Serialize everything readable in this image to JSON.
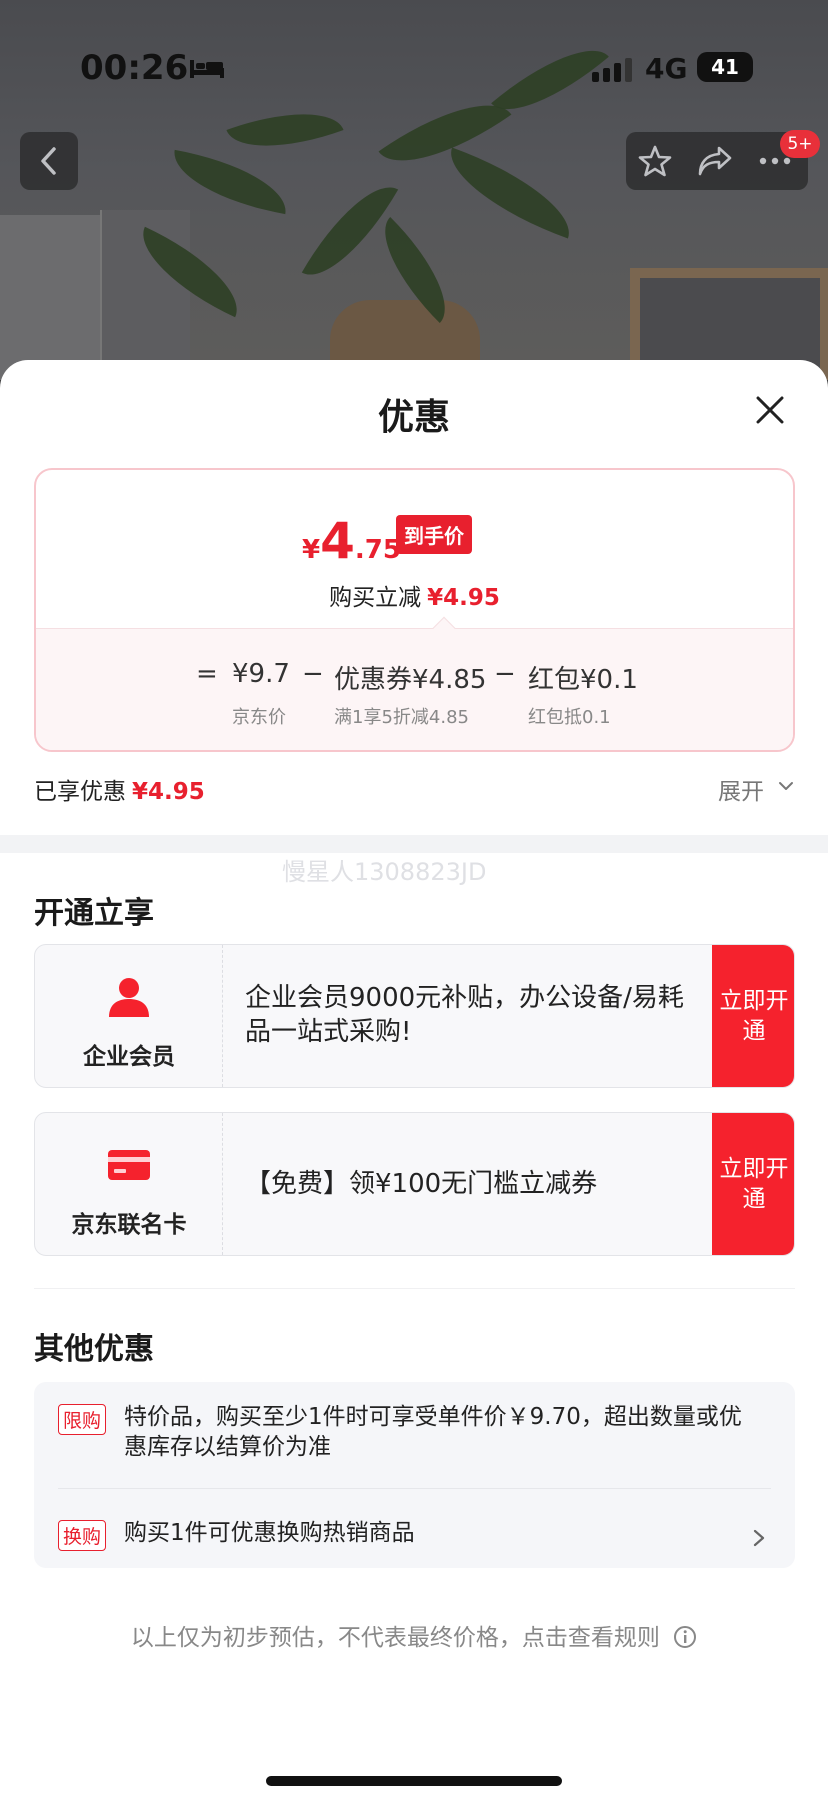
{
  "status_bar": {
    "time": "00:26",
    "network": "4G",
    "battery": "41"
  },
  "top_nav": {
    "badge": "5+"
  },
  "sheet": {
    "title": "优惠",
    "price_card": {
      "currency": "¥",
      "final_int": "4",
      "final_dec": ".75",
      "final_tag": "到手价",
      "reduce_label": "购买立减",
      "reduce_value": "¥4.95",
      "formula": {
        "equals": "=",
        "base_price": "¥9.7",
        "base_label": "京东价",
        "minus1": "−",
        "coupon": "优惠券¥4.85",
        "coupon_label": "满1享5折减4.85",
        "minus2": "−",
        "redpacket": "红包¥0.1",
        "redpacket_label": "红包抵0.1"
      }
    },
    "enjoyed_label": "已享优惠",
    "enjoyed_value": "¥4.95",
    "expand_label": "展开",
    "watermark": "慢星人1308823JD",
    "open_section": {
      "title": "开通立享",
      "cards": [
        {
          "name": "企业会员",
          "description": "企业会员9000元补贴，办公设备/易耗品一站式采购!",
          "button": "立即开通"
        },
        {
          "name": "京东联名卡",
          "description": "【免费】领¥100无门槛立减券",
          "button": "立即开通"
        }
      ]
    },
    "other_section": {
      "title": "其他优惠",
      "items": [
        {
          "tag": "限购",
          "text": "特价品，购买至少1件时可享受单件价￥9.70，超出数量或优惠库存以结算价为准"
        },
        {
          "tag": "换购",
          "text": "购买1件可优惠换购热销商品"
        }
      ]
    },
    "footnote": "以上仅为初步预估，不代表最终价格，点击查看规则"
  },
  "colors": {
    "accent_red": "#e8202e",
    "button_red": "#f5222d"
  }
}
